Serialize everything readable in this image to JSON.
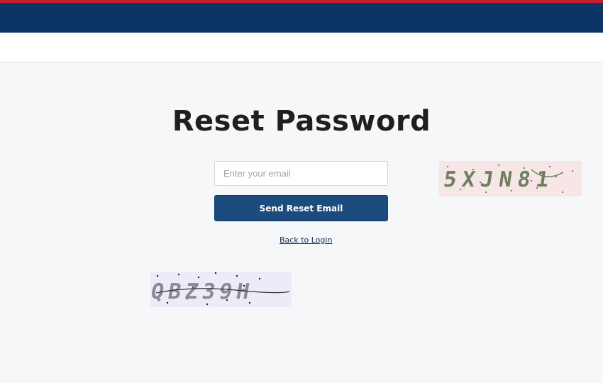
{
  "header": {
    "accent_color": "#c61f2c",
    "bar_color": "#0d3466"
  },
  "page": {
    "title": "Reset Password"
  },
  "form": {
    "email_placeholder": "Enter your email",
    "email_value": "",
    "send_label": "Send Reset Email",
    "back_link": "Back to Login"
  },
  "captchas": [
    {
      "text": "5XJN81",
      "color": "#6f7f5f",
      "background": "#f7e6e6"
    },
    {
      "text": "QBZ39H",
      "color": "#8a8a95",
      "background": "#ebecf7"
    }
  ]
}
